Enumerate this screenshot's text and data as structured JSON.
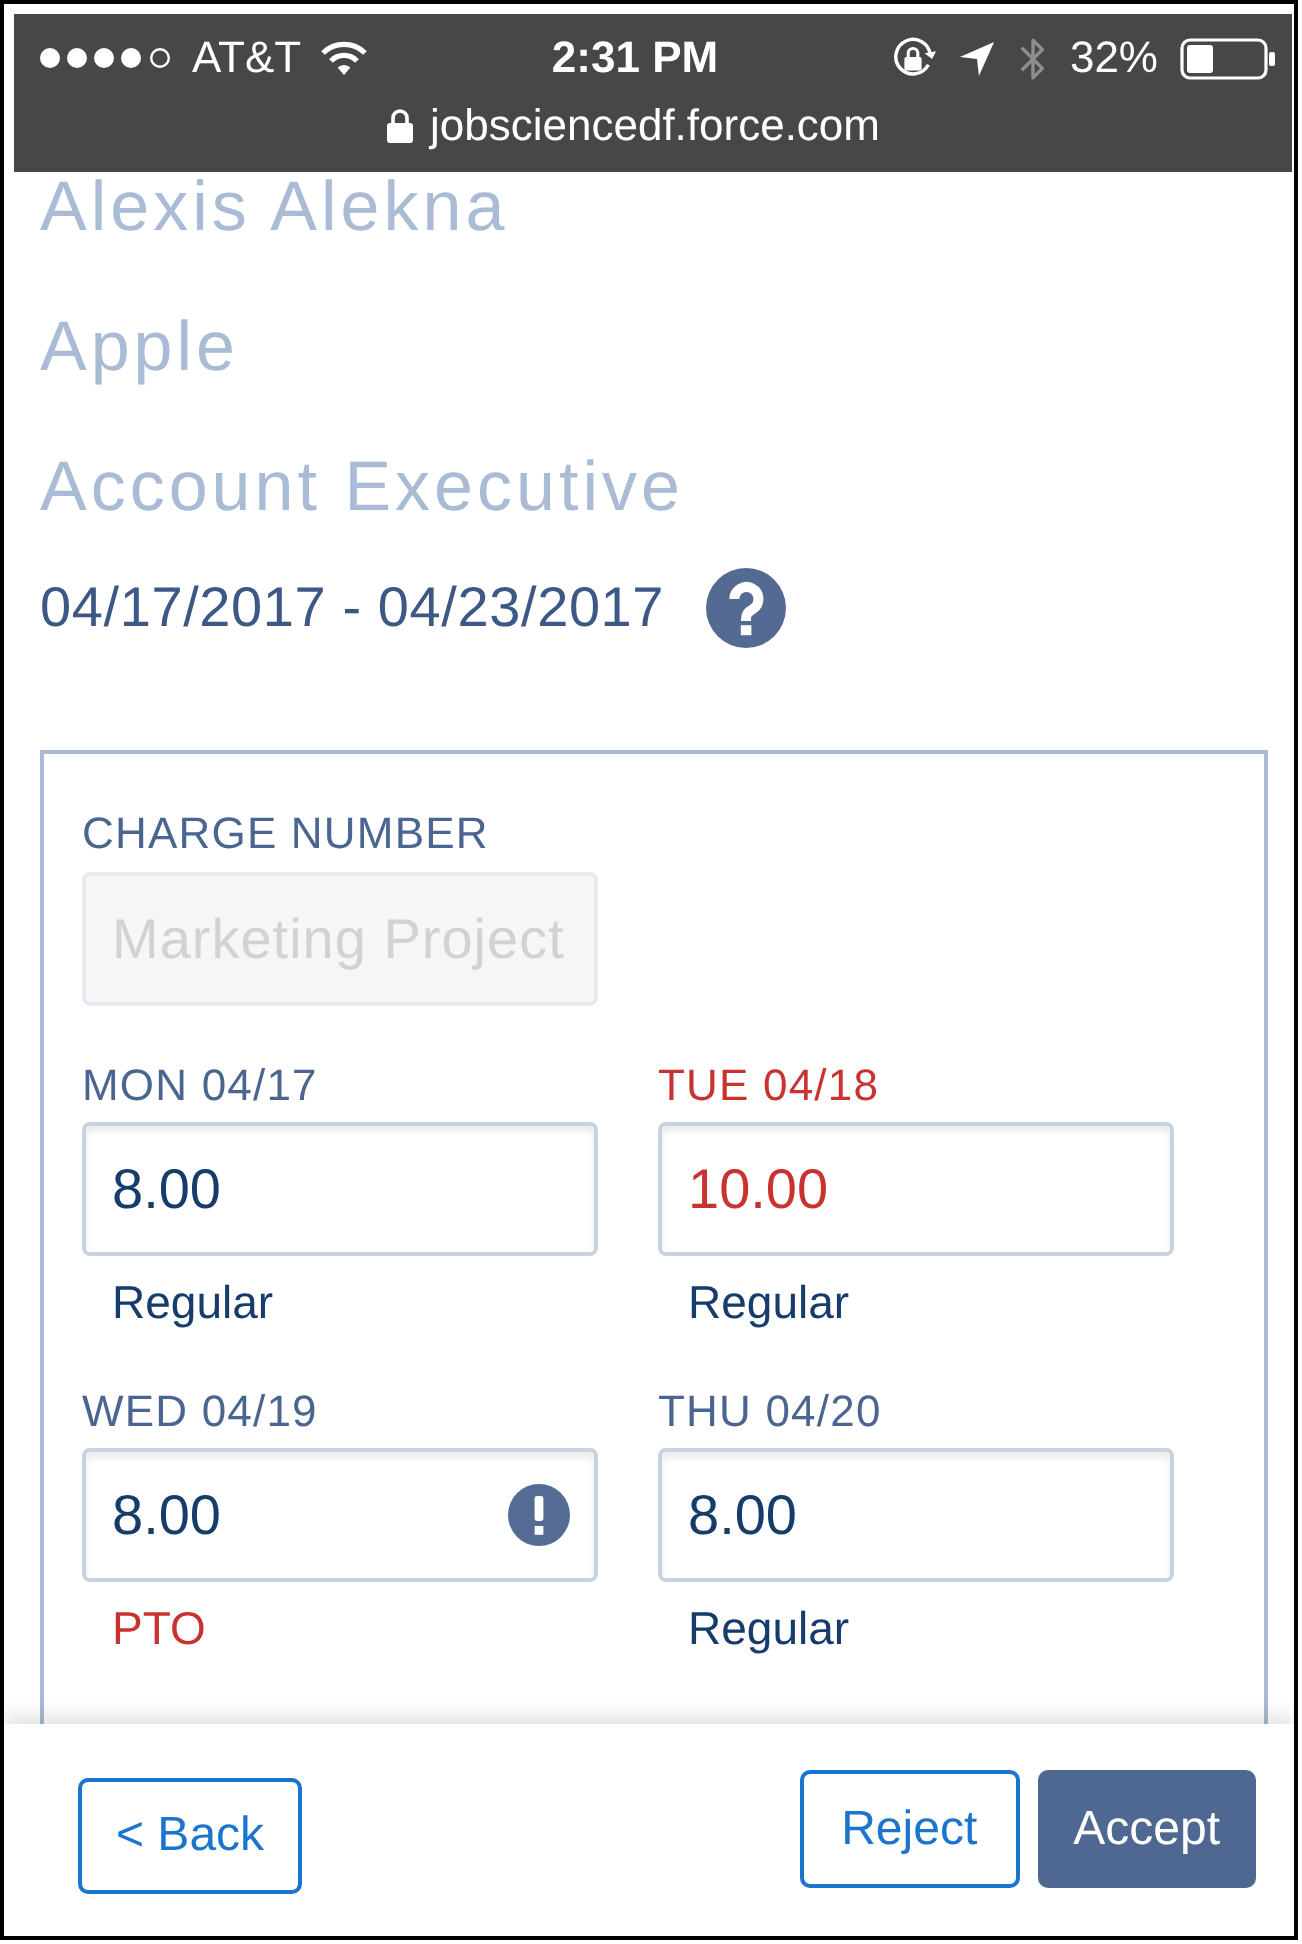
{
  "status_bar": {
    "carrier": "AT&T",
    "time": "2:31 PM",
    "battery": "32%",
    "url": "jobsciencedf.force.com"
  },
  "header": {
    "name": "Alexis Alekna",
    "company": "Apple",
    "job_title": "Account Executive",
    "date_range": "04/17/2017 - 04/23/2017"
  },
  "charge_number": {
    "label": "CHARGE NUMBER",
    "value": "Marketing Project",
    "disabled": true
  },
  "days": [
    {
      "label": "MON 04/17",
      "value": "8.00",
      "pay_type": "Regular",
      "alert": false,
      "pay_type_alert": false,
      "warning": false
    },
    {
      "label": "TUE 04/18",
      "value": "10.00",
      "pay_type": "Regular",
      "alert": true,
      "pay_type_alert": false,
      "warning": false
    },
    {
      "label": "WED 04/19",
      "value": "8.00",
      "pay_type": "PTO",
      "alert": false,
      "pay_type_alert": true,
      "warning": true
    },
    {
      "label": "THU 04/20",
      "value": "8.00",
      "pay_type": "Regular",
      "alert": false,
      "pay_type_alert": false,
      "warning": false
    }
  ],
  "buttons": [
    {
      "label": "< Back",
      "kind": "outline"
    },
    {
      "label": "Reject",
      "kind": "outline"
    },
    {
      "label": "Accept",
      "kind": "primary"
    }
  ]
}
